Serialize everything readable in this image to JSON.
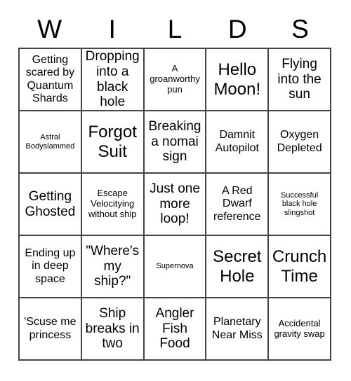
{
  "card": {
    "header_letters": [
      "W",
      "I",
      "L",
      "D",
      "S"
    ],
    "rows": [
      [
        {
          "text": "Getting scared by Quantum Shards",
          "size": "sz-md"
        },
        {
          "text": "Dropping into a black hole",
          "size": "sz-lg"
        },
        {
          "text": "A groanworthy pun",
          "size": "sz-sm"
        },
        {
          "text": "Hello Moon!",
          "size": "sz-xl"
        },
        {
          "text": "Flying into the sun",
          "size": "sz-lg"
        }
      ],
      [
        {
          "text": "Astral Bodyslammed",
          "size": "sz-xs"
        },
        {
          "text": "Forgot Suit",
          "size": "sz-xl"
        },
        {
          "text": "Breaking a nomai sign",
          "size": "sz-lg"
        },
        {
          "text": "Damnit Autopilot",
          "size": "sz-md"
        },
        {
          "text": "Oxygen Depleted",
          "size": "sz-md"
        }
      ],
      [
        {
          "text": "Getting Ghosted",
          "size": "sz-lg"
        },
        {
          "text": "Escape Velocitying without ship",
          "size": "sz-sm"
        },
        {
          "text": "Just one more loop!",
          "size": "sz-lg"
        },
        {
          "text": "A Red Dwarf reference",
          "size": "sz-md"
        },
        {
          "text": "Successful black hole slingshot",
          "size": "sz-xs"
        }
      ],
      [
        {
          "text": "Ending up in deep space",
          "size": "sz-md"
        },
        {
          "text": "\"Where's my ship?\"",
          "size": "sz-lg"
        },
        {
          "text": "Supernova",
          "size": "sz-xs"
        },
        {
          "text": "Secret Hole",
          "size": "sz-xl"
        },
        {
          "text": "Crunch Time",
          "size": "sz-xl"
        }
      ],
      [
        {
          "text": "'Scuse me princess",
          "size": "sz-md"
        },
        {
          "text": "Ship breaks in two",
          "size": "sz-lg"
        },
        {
          "text": "Angler Fish Food",
          "size": "sz-lg"
        },
        {
          "text": "Planetary Near Miss",
          "size": "sz-md"
        },
        {
          "text": "Accidental gravity swap",
          "size": "sz-sm"
        }
      ]
    ]
  }
}
